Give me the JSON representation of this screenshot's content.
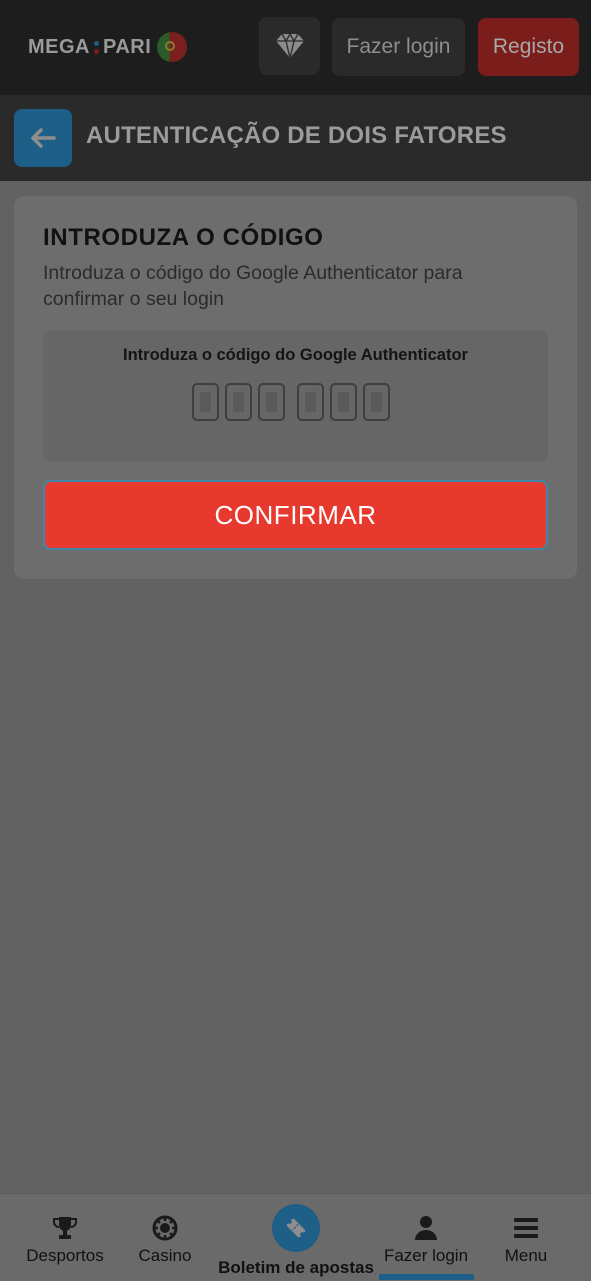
{
  "header": {
    "logo_text_left": "MEGA",
    "logo_text_right": "PARI",
    "diamond_icon": "diamond-icon",
    "login_label": "Fazer login",
    "register_label": "Registo"
  },
  "titlebar": {
    "back_icon": "arrow-left-icon",
    "title": "AUTENTICAÇÃO DE DOIS FATORES"
  },
  "card": {
    "heading": "INTRODUZA O CÓDIGO",
    "description": "Introduza o código do Google Authenticator para confirmar o seu login",
    "code_label": "Introduza o código do Google Authenticator",
    "confirm_label": "CONFIRMAR"
  },
  "bottom_nav": {
    "items": [
      {
        "label": "Desportos",
        "icon": "trophy-icon"
      },
      {
        "label": "Casino",
        "icon": "casino-chip-icon"
      },
      {
        "label": "Boletim de apostas",
        "icon": "ticket-icon"
      },
      {
        "label": "Fazer login",
        "icon": "user-icon"
      },
      {
        "label": "Menu",
        "icon": "hamburger-menu-icon"
      }
    ]
  },
  "colors": {
    "accent_blue": "#1d5f86",
    "confirm_red": "#e8392f",
    "register_red": "#7b1e1b"
  }
}
